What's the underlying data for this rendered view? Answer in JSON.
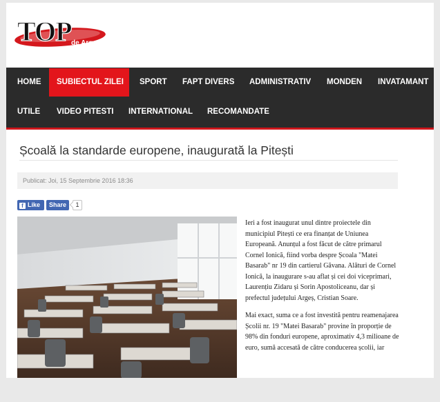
{
  "logo": {
    "main_text": "TOP",
    "sub_text": "de Argeș"
  },
  "nav": {
    "row1": [
      {
        "label": "HOME",
        "active": false
      },
      {
        "label": "SUBIECTUL ZILEI",
        "active": true
      },
      {
        "label": "SPORT",
        "active": false
      },
      {
        "label": "FAPT DIVERS",
        "active": false
      },
      {
        "label": "ADMINISTRATIV",
        "active": false
      },
      {
        "label": "MONDEN",
        "active": false
      },
      {
        "label": "INVATAMANT",
        "active": false
      }
    ],
    "row2": [
      {
        "label": "UTILE"
      },
      {
        "label": "VIDEO PITESTI"
      },
      {
        "label": "INTERNATIONAL"
      },
      {
        "label": "RECOMANDATE"
      }
    ]
  },
  "article": {
    "title": "Școală la standarde europene, inaugurată la Pitești",
    "published": "Publicat: Joi, 15 Septembrie 2016 18:36",
    "paragraphs": [
      "Ieri a fost inaugurat unul dintre proiectele din municipiul Pitești ce era finanțat de Uniunea Europeană. Anunțul a fost făcut de către primarul Cornel Ionică, fiind vorba despre Școala \"Matei Basarab\" nr 19 din cartierul Găvana. Alături de Cornel Ionică, la inaugurare s-au aflat și cei doi viceprimari, Laurențiu Zidaru și Sorin Apostoliceanu, dar și prefectul județului Argeș, Cristian Soare.",
      "Mai exact, suma ce a fost investită pentru reamenajarea Școlii nr. 19 \"Matei Basarab\" provine în proporție de 98% din fonduri europene, aproximativ 4,3 milioane de euro, sumă accesată de către conducerea școlii, iar"
    ]
  },
  "share": {
    "like_label": "Like",
    "share_label": "Share",
    "count": "1",
    "fb_letter": "f"
  },
  "colors": {
    "nav_bg": "#2b2b2b",
    "accent_red": "#e3151b",
    "fb_blue": "#4267b2",
    "page_bg": "#e9e9e9"
  }
}
